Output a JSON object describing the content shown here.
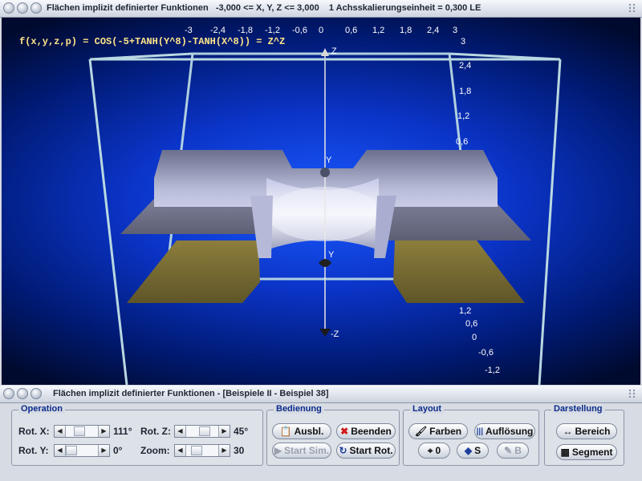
{
  "window": {
    "title": "Flächen implizit definierter Funktionen   -3,000 <= X, Y, Z <= 3,000    1 Achsskalierungseinheit = 0,300 LE"
  },
  "plot": {
    "formula": "f(x,y,z,p) = COS(-5+TANH(Y^8)-TANH(X^8)) = Z^Z",
    "x_ticks": [
      "-3",
      "-2,4",
      "-1,8",
      "-1,2",
      "-0,6",
      "0",
      "0,6",
      "1,2",
      "1,8",
      "2,4",
      "3"
    ],
    "z_ticks_top": [
      "3",
      "2,4",
      "1,8",
      "1,2",
      "0,6"
    ],
    "z_ticks_bottom": [
      "1,2",
      "0,6",
      "0",
      "-0,6",
      "-1,2"
    ],
    "axis_z": "Z",
    "axis_neg_z": "-Z",
    "axis_y_top": "Y",
    "axis_y_bottom": "Y"
  },
  "panel": {
    "title": "Flächen implizit definierter Funktionen - [Beispiele II - Beispiel 38]",
    "operation": {
      "title": "Operation",
      "rot_x_label": "Rot. X:",
      "rot_x_value": "111°",
      "rot_y_label": "Rot. Y:",
      "rot_y_value": "0°",
      "rot_z_label": "Rot. Z:",
      "rot_z_value": "45°",
      "zoom_label": "Zoom:",
      "zoom_value": "30"
    },
    "bedienung": {
      "title": "Bedienung",
      "ausbl": "Ausbl.",
      "beenden": "Beenden",
      "start_sim": "Start Sim.",
      "start_rot": "Start Rot."
    },
    "layout": {
      "title": "Layout",
      "farben": "Farben",
      "aufloesung": "Auflösung",
      "zero": "0",
      "s": "S",
      "b": "B"
    },
    "darstellung": {
      "title": "Darstellung",
      "bereich": "Bereich",
      "segment": "Segment"
    }
  }
}
